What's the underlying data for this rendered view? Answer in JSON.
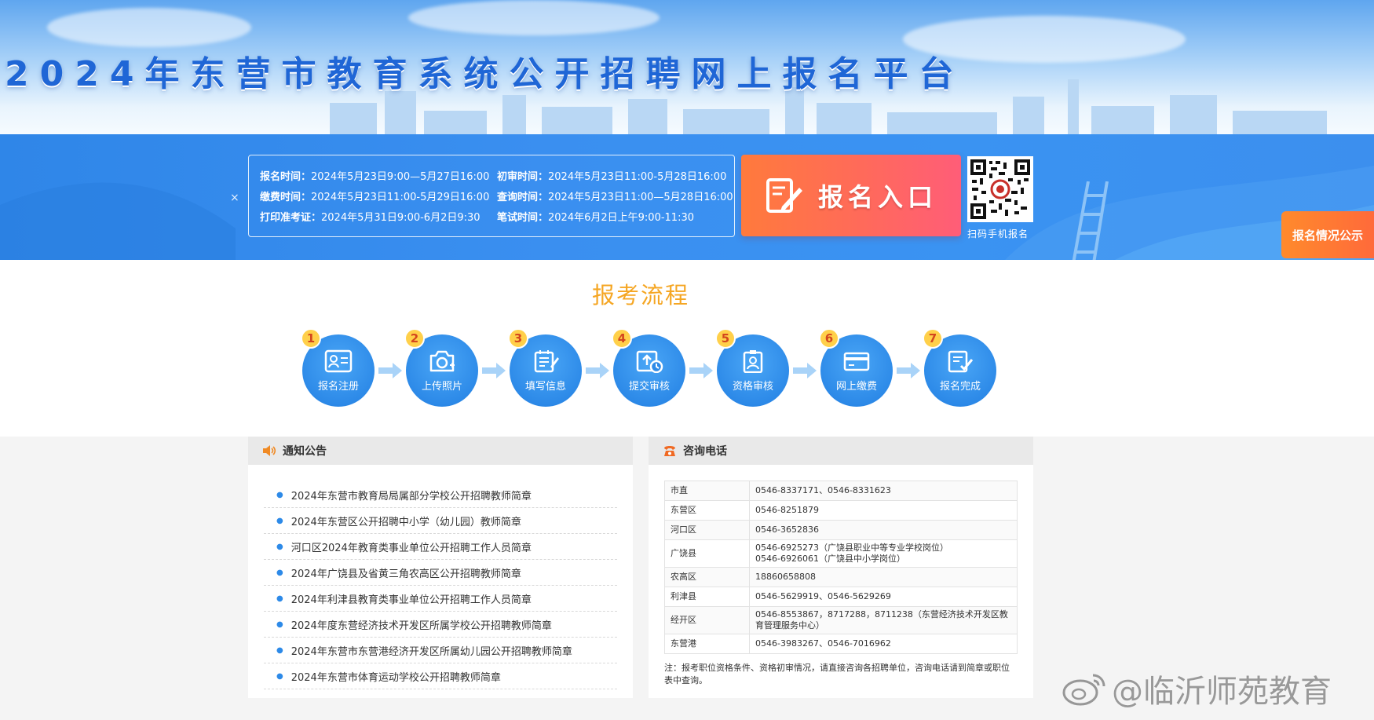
{
  "header": {
    "title": "2024年东营市教育系统公开招聘网上报名平台"
  },
  "schedule": {
    "close_symbol": "×",
    "rows": [
      [
        {
          "label": "报名时间：",
          "value": "2024年5月23日9:00—5月27日16:00"
        },
        {
          "label": "初审时间：",
          "value": "2024年5月23日11:00-5月28日16:00"
        }
      ],
      [
        {
          "label": "缴费时间：",
          "value": "2024年5月23日11:00-5月29日16:00"
        },
        {
          "label": "查询时间：",
          "value": "2024年5月23日11:00—5月28日16:00"
        }
      ],
      [
        {
          "label": "打印准考证：",
          "value": "2024年5月31日9:00-6月2日9:30"
        },
        {
          "label": "笔试时间：",
          "value": "2024年6月2日上午9:00-11:30"
        }
      ]
    ]
  },
  "apply": {
    "label": "报名入口",
    "icon": "edit-form-icon"
  },
  "qr": {
    "caption": "扫码手机报名"
  },
  "status_tab": {
    "label": "报名情况公示"
  },
  "process": {
    "title": "报考流程",
    "steps": [
      {
        "num": "1",
        "label": "报名注册",
        "icon": "id-card-icon"
      },
      {
        "num": "2",
        "label": "上传照片",
        "icon": "camera-icon"
      },
      {
        "num": "3",
        "label": "填写信息",
        "icon": "form-icon"
      },
      {
        "num": "4",
        "label": "提交审核",
        "icon": "upload-clock-icon"
      },
      {
        "num": "5",
        "label": "资格审核",
        "icon": "badge-icon"
      },
      {
        "num": "6",
        "label": "网上缴费",
        "icon": "card-icon"
      },
      {
        "num": "7",
        "label": "报名完成",
        "icon": "check-doc-icon"
      }
    ]
  },
  "notice": {
    "title": "通知公告",
    "items": [
      "2024年东营市教育局局属部分学校公开招聘教师简章",
      "2024年东营区公开招聘中小学（幼儿园）教师简章",
      "河口区2024年教育类事业单位公开招聘工作人员简章",
      "2024年广饶县及省黄三角农高区公开招聘教师简章",
      "2024年利津县教育类事业单位公开招聘工作人员简章",
      "2024年度东营经济技术开发区所属学校公开招聘教师简章",
      "2024年东营市东营港经济开发区所属幼儿园公开招聘教师简章",
      "2024年东营市体育运动学校公开招聘教师简章"
    ]
  },
  "contact": {
    "title": "咨询电话",
    "rows": [
      {
        "area": "市直",
        "phone": "0546-8337171、0546-8331623"
      },
      {
        "area": "东营区",
        "phone": "0546-8251879"
      },
      {
        "area": "河口区",
        "phone": "0546-3652836"
      },
      {
        "area": "广饶县",
        "phone": "0546-6925273（广饶县职业中等专业学校岗位）",
        "phone2": "0546-6926061（广饶县中小学岗位）"
      },
      {
        "area": "农高区",
        "phone": "18860658808"
      },
      {
        "area": "利津县",
        "phone": "0546-5629919、0546-5629269"
      },
      {
        "area": "经开区",
        "phone": "0546-8553867，8717288，8711238（东营经济技术开发区教育管理服务中心）"
      },
      {
        "area": "东营港",
        "phone": "0546-3983267、0546-7016962"
      }
    ],
    "note": "注：报考职位资格条件、资格初审情况，请直接咨询各招聘单位，咨询电话请到简章或职位表中查询。"
  },
  "watermark": {
    "text": "@临沂师苑教育"
  },
  "colors": {
    "brand_blue": "#2d8ae8",
    "accent_orange": "#f5a623",
    "apply_gradient_start": "#ff7a3c",
    "apply_gradient_end": "#ff5d78",
    "step_number": "#ffd04a"
  }
}
